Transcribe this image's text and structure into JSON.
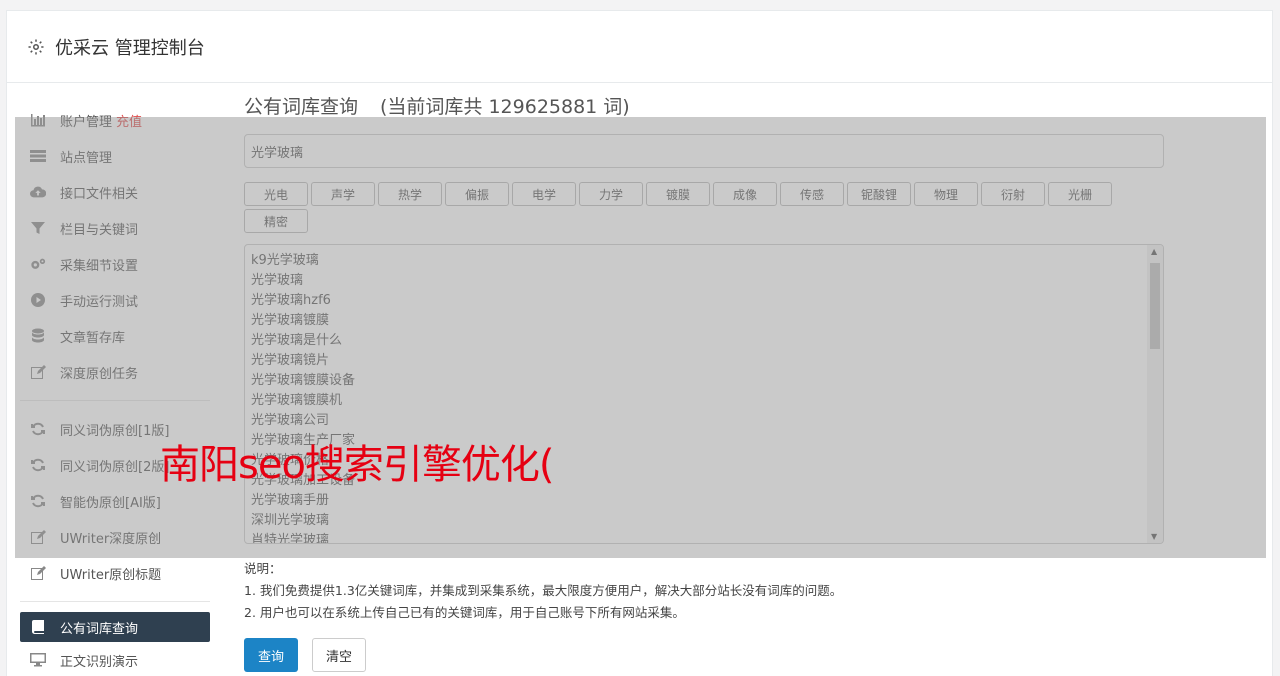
{
  "header": {
    "title": "优采云 管理控制台",
    "icon": "gear-icon"
  },
  "sidebar": {
    "group1": [
      {
        "label": "账户管理",
        "extra": "充值",
        "icon": "bar-chart-icon"
      },
      {
        "label": "站点管理",
        "icon": "server-icon"
      },
      {
        "label": "接口文件相关",
        "icon": "cloud-upload-icon"
      },
      {
        "label": "栏目与关键词",
        "icon": "filter-icon"
      },
      {
        "label": "采集细节设置",
        "icon": "gears-icon"
      },
      {
        "label": "手动运行测试",
        "icon": "play-circle-icon"
      },
      {
        "label": "文章暂存库",
        "icon": "database-icon"
      },
      {
        "label": "深度原创任务",
        "icon": "edit-icon"
      }
    ],
    "group2": [
      {
        "label": "同义词伪原创[1版]",
        "icon": "refresh-icon"
      },
      {
        "label": "同义词伪原创[2版]",
        "icon": "refresh-icon"
      },
      {
        "label": "智能伪原创[AI版]",
        "icon": "refresh-icon"
      },
      {
        "label": "UWriter深度原创",
        "icon": "edit-icon"
      },
      {
        "label": "UWriter原创标题",
        "icon": "edit-icon"
      }
    ],
    "group3": [
      {
        "label": "公有词库查询",
        "icon": "book-icon"
      },
      {
        "label": "正文识别演示",
        "icon": "monitor-icon"
      }
    ]
  },
  "main": {
    "title": "公有词库查询",
    "count_text": "(当前词库共 129625881 词)",
    "search_value": "光学玻璃",
    "tags": [
      "光电",
      "声学",
      "热学",
      "偏振",
      "电学",
      "力学",
      "镀膜",
      "成像",
      "传感",
      "铌酸锂",
      "物理",
      "衍射",
      "光栅",
      "精密"
    ],
    "results": [
      "k9光学玻璃",
      "光学玻璃",
      "光学玻璃hzf6",
      "光学玻璃镀膜",
      "光学玻璃是什么",
      "光学玻璃镜片",
      "光学玻璃镀膜设备",
      "光学玻璃镀膜机",
      "光学玻璃公司",
      "光学玻璃生产厂家",
      "光学玻璃价格",
      "光学玻璃加工设备",
      "光学玻璃手册",
      "深圳光学玻璃",
      "肖特光学玻璃"
    ],
    "note_title": "说明：",
    "note_lines": [
      "1. 我们免费提供1.3亿关键词库，并集成到采集系统，最大限度方便用户，解决大部分站长没有词库的问题。",
      "2. 用户也可以在系统上传自己已有的关键词库，用于自己账号下所有网站采集。"
    ],
    "query_button": "查询",
    "clear_button": "清空"
  },
  "overlay": {
    "text": "南阳seo搜索引擎优化("
  }
}
